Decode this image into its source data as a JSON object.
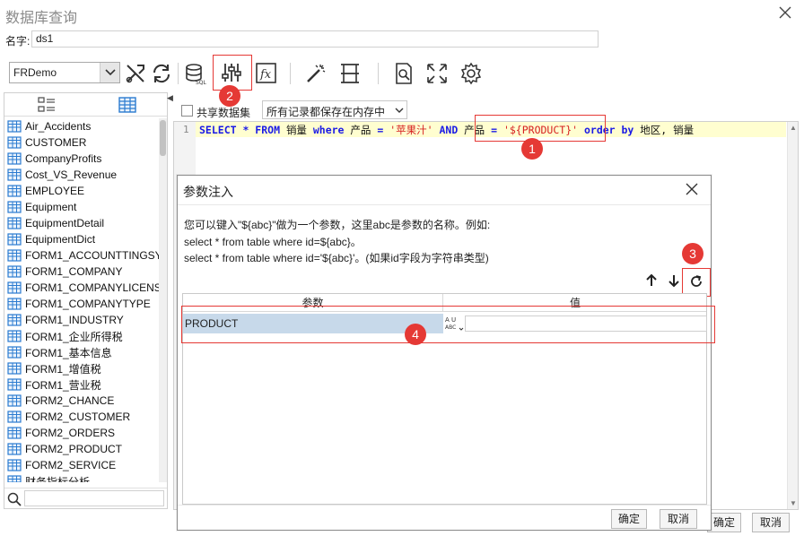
{
  "window": {
    "title": "数据库查询"
  },
  "name_field": {
    "label": "名字:",
    "value": "ds1"
  },
  "toolbar": {
    "connection": "FRDemo",
    "icons": [
      "edit-connection-icon",
      "refresh-icon",
      "sql-database-icon",
      "parameter-settings-icon",
      "formula-icon",
      "magic-wand-icon",
      "column-split-icon",
      "preview-icon",
      "fullscreen-icon",
      "settings-gear-icon"
    ]
  },
  "left_panel": {
    "tables": [
      "Air_Accidents",
      "CUSTOMER",
      "CompanyProfits",
      "Cost_VS_Revenue",
      "EMPLOYEE",
      "Equipment",
      "EquipmentDetail",
      "EquipmentDict",
      "FORM1_ACCOUNTTINGSY",
      "FORM1_COMPANY",
      "FORM1_COMPANYLICENS",
      "FORM1_COMPANYTYPE",
      "FORM1_INDUSTRY",
      "FORM1_企业所得税",
      "FORM1_基本信息",
      "FORM1_增值税",
      "FORM1_营业税",
      "FORM2_CHANCE",
      "FORM2_CUSTOMER",
      "FORM2_ORDERS",
      "FORM2_PRODUCT",
      "FORM2_SERVICE",
      "财务指标分析"
    ]
  },
  "sql_panel": {
    "share_label": "共享数据集",
    "cache_option": "所有记录都保存在内存中",
    "line_number": "1",
    "sql": {
      "p1": "SELECT * FROM ",
      "p2": "销量",
      "p3": " where ",
      "p4": "产品",
      "p5": " = ",
      "p6": "'苹果汁'",
      "p7": " AND ",
      "p8": "产品",
      "p9": " = ",
      "p10": "'${PRODUCT}'",
      "p11": " order by ",
      "p12": "地区, 销量"
    }
  },
  "main_buttons": {
    "ok": "确定",
    "cancel": "取消"
  },
  "param_dialog": {
    "title": "参数注入",
    "desc1": "您可以键入\"${abc}\"做为一个参数，这里abc是参数的名称。例如:",
    "desc2": "select * from table where id=${abc}。",
    "desc3": "select * from table where id='${abc}'。(如果id字段为字符串类型)",
    "col_param": "参数",
    "col_value": "值",
    "rows": [
      {
        "name": "PRODUCT",
        "value": ""
      }
    ],
    "type_icon_text": "AU ABC",
    "ok": "确定",
    "cancel": "取消"
  },
  "callouts": [
    "1",
    "2",
    "3",
    "4"
  ],
  "colors": {
    "highlight": "#e53935",
    "keyword": "#1a1ae6",
    "string": "#d62020",
    "selected_row": "#c7d9ea"
  }
}
